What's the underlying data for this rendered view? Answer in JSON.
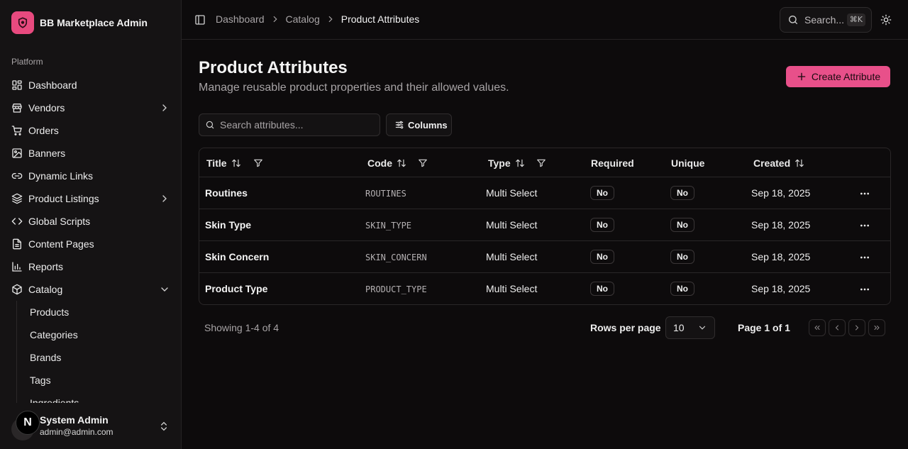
{
  "app": {
    "title": "BB Marketplace Admin"
  },
  "sidebar": {
    "group_label": "Platform",
    "items": [
      {
        "label": "Dashboard",
        "icon": "dashboard-icon"
      },
      {
        "label": "Vendors",
        "icon": "store-icon",
        "expandable": true
      },
      {
        "label": "Orders",
        "icon": "cart-icon"
      },
      {
        "label": "Banners",
        "icon": "image-icon"
      },
      {
        "label": "Dynamic Links",
        "icon": "link-icon"
      },
      {
        "label": "Product Listings",
        "icon": "layers-icon",
        "expandable": true
      },
      {
        "label": "Global Scripts",
        "icon": "code-icon"
      },
      {
        "label": "Content Pages",
        "icon": "file-icon"
      },
      {
        "label": "Reports",
        "icon": "bar-chart-icon"
      },
      {
        "label": "Catalog",
        "icon": "package-icon",
        "expanded": true
      }
    ],
    "catalog_sub": [
      "Products",
      "Categories",
      "Brands",
      "Tags",
      "Ingredients"
    ],
    "user": {
      "name": "System Admin",
      "email": "admin@admin.com",
      "badge": "N"
    }
  },
  "header": {
    "breadcrumbs": [
      "Dashboard",
      "Catalog",
      "Product Attributes"
    ],
    "search_placeholder": "Search...",
    "search_shortcut": "⌘K"
  },
  "main": {
    "title": "Product Attributes",
    "subtitle": "Manage reusable product properties and their allowed values.",
    "create_label": "Create Attribute",
    "filter_placeholder": "Search attributes...",
    "columns_label": "Columns"
  },
  "table": {
    "headers": [
      "Title",
      "Code",
      "Type",
      "Required",
      "Unique",
      "Created"
    ],
    "rows": [
      {
        "title": "Routines",
        "code": "ROUTINES",
        "type": "Multi Select",
        "required": "No",
        "unique": "No",
        "created": "Sep 18, 2025"
      },
      {
        "title": "Skin Type",
        "code": "SKIN_TYPE",
        "type": "Multi Select",
        "required": "No",
        "unique": "No",
        "created": "Sep 18, 2025"
      },
      {
        "title": "Skin Concern",
        "code": "SKIN_CONCERN",
        "type": "Multi Select",
        "required": "No",
        "unique": "No",
        "created": "Sep 18, 2025"
      },
      {
        "title": "Product Type",
        "code": "PRODUCT_TYPE",
        "type": "Multi Select",
        "required": "No",
        "unique": "No",
        "created": "Sep 18, 2025"
      }
    ]
  },
  "footer": {
    "showing": "Showing 1-4 of 4",
    "rows_per_page_label": "Rows per page",
    "rows_per_page_value": "10",
    "page_info": "Page 1 of 1"
  },
  "colors": {
    "accent": "#e8508a",
    "background": "#0d0b0c",
    "sidebar": "#151314"
  }
}
